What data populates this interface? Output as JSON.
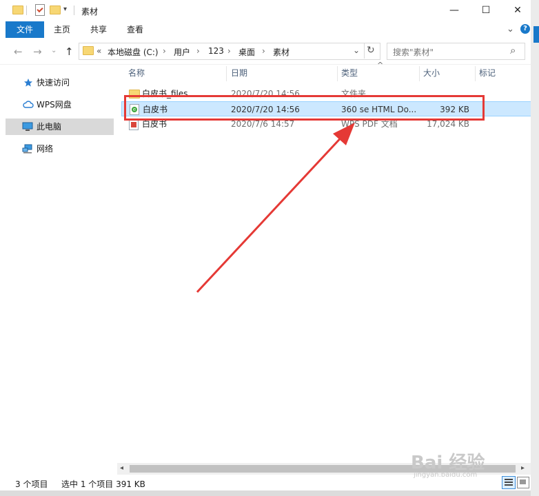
{
  "window": {
    "title": "素材",
    "controls": {
      "minimize": "—",
      "maximize": "☐",
      "close": "✕"
    }
  },
  "ribbon": {
    "tabs": [
      "文件",
      "主页",
      "共享",
      "查看"
    ],
    "expand": "⌄",
    "help": "?"
  },
  "address": {
    "prefix": "«",
    "crumbs": [
      "本地磁盘 (C:)",
      "用户",
      "123",
      "桌面",
      "素材"
    ],
    "sep": "›",
    "dropdown": "⌄",
    "refresh": "↻"
  },
  "search": {
    "placeholder": "搜索\"素材\"",
    "icon": "⌕"
  },
  "nav_buttons": {
    "back": "←",
    "forward": "→",
    "recent": "⌄",
    "up": "↑"
  },
  "sidebar": {
    "items": [
      {
        "label": "快速访问",
        "icon": "star-icon"
      },
      {
        "label": "WPS网盘",
        "icon": "cloud-icon"
      },
      {
        "label": "此电脑",
        "icon": "computer-icon",
        "selected": true
      },
      {
        "label": "网络",
        "icon": "network-icon"
      }
    ]
  },
  "columns": {
    "name": "名称",
    "date": "日期",
    "type": "类型",
    "size": "大小",
    "tags": "标记",
    "sort_indicator": "^"
  },
  "files": [
    {
      "name": "白皮书_files",
      "date": "2020/7/20 14:56",
      "type": "文件夹",
      "size": "",
      "icon": "folder-icon"
    },
    {
      "name": "白皮书",
      "date": "2020/7/20 14:56",
      "type": "360 se HTML Do...",
      "size": "392 KB",
      "icon": "html-file-icon",
      "selected": true
    },
    {
      "name": "白皮书",
      "date": "2020/7/6 14:57",
      "type": "WPS PDF 文档",
      "size": "17,024 KB",
      "icon": "pdf-file-icon"
    }
  ],
  "status": {
    "count": "3 个项目",
    "selected": "选中 1 个项目  391 KB"
  },
  "watermark": {
    "main": "Bai 经验",
    "sub": "jingyan.baidu.com"
  },
  "colors": {
    "accent": "#1979ca",
    "selection": "#cce8ff",
    "highlight": "#e53935"
  }
}
